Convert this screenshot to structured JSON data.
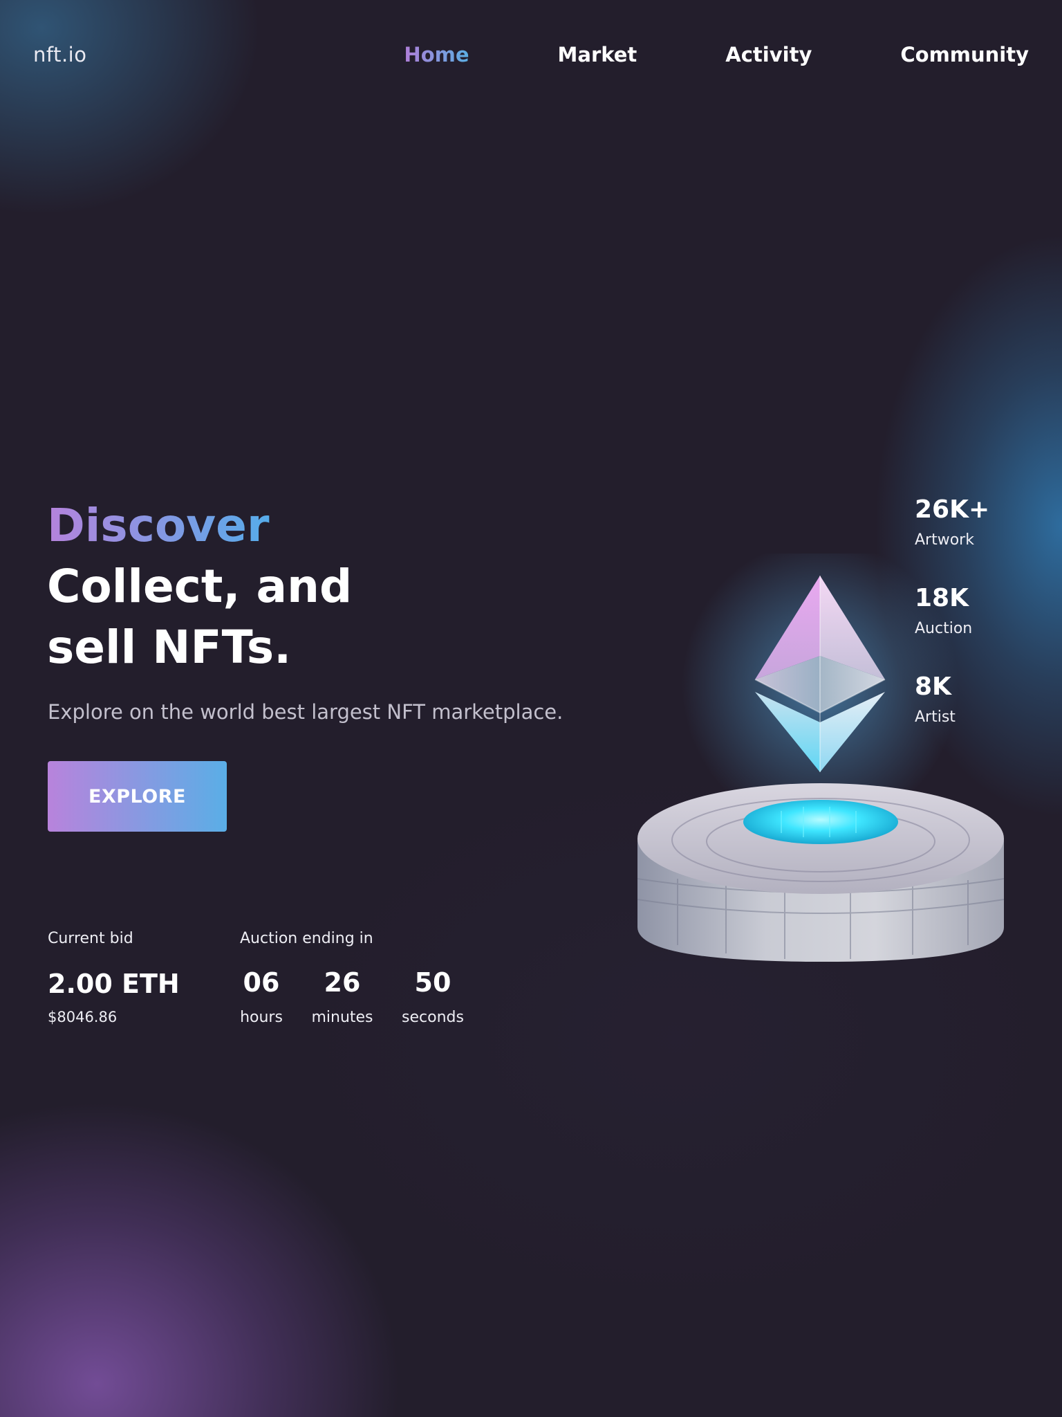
{
  "header": {
    "logo": "nft.io",
    "nav": [
      {
        "label": "Home",
        "active": true
      },
      {
        "label": "Market",
        "active": false
      },
      {
        "label": "Activity",
        "active": false
      },
      {
        "label": "Community",
        "active": false
      }
    ]
  },
  "hero": {
    "highlight": "Discover",
    "title_line1": "Collect, and",
    "title_line2": "sell NFTs.",
    "subtitle": "Explore on the world best largest NFT marketplace.",
    "cta_label": "EXPLORE"
  },
  "bid": {
    "label": "Current bid",
    "eth": "2.00 ETH",
    "usd": "$8046.86"
  },
  "auction": {
    "label": "Auction ending in",
    "hours_value": "06",
    "hours_label": "hours",
    "minutes_value": "26",
    "minutes_label": "minutes",
    "seconds_value": "50",
    "seconds_label": "seconds"
  },
  "stats": [
    {
      "value": "26K+",
      "label": "Artwork"
    },
    {
      "value": "18K",
      "label": "Auction"
    },
    {
      "value": "8K",
      "label": "Artist"
    }
  ],
  "colors": {
    "background": "#231e2c",
    "gradient_start": "#b583dc",
    "gradient_end": "#56acea",
    "glow_blue": "#307ab2",
    "glow_purple": "#8054a8",
    "portal_cyan": "#35e6ff"
  },
  "illustration": {
    "icon": "ethereum-crystal-on-pedestal"
  }
}
